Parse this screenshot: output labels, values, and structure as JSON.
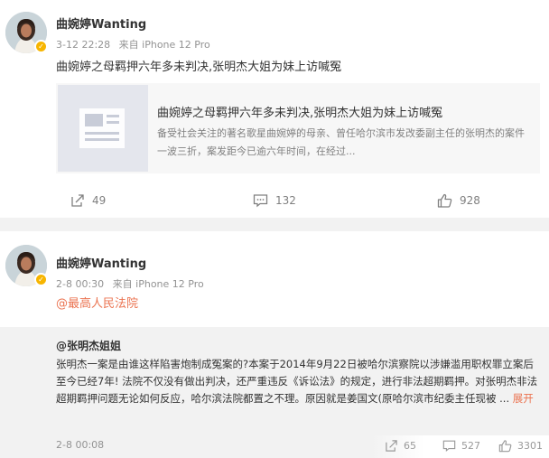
{
  "posts": [
    {
      "username": "曲婉婷Wanting",
      "time": "3-12 22:28",
      "source": "来自 iPhone 12 Pro",
      "text": "曲婉婷之母羁押六年多未判决,张明杰大姐为妹上访喊冤",
      "link_card": {
        "title": "曲婉婷之母羁押六年多未判决,张明杰大姐为妹上访喊冤",
        "summary": "备受社会关注的著名歌星曲婉婷的母亲、曾任哈尔滨市发改委副主任的张明杰的案件一波三折，案发距今已逾六年时间，在经过..."
      },
      "actions": {
        "repost": "49",
        "comment": "132",
        "like": "928"
      }
    },
    {
      "username": "曲婉婷Wanting",
      "time": "2-8 00:30",
      "source": "来自 iPhone 12 Pro",
      "mention": "@最高人民法院",
      "repost": {
        "author": "@张明杰姐姐",
        "text": "张明杰一案是由谁这样陷害炮制成冤案的?本案于2014年9月22日被哈尔滨察院以涉嫌滥用职权罪立案后至今已经7年! 法院不仅没有做出判决，还严重违反《诉讼法》的规定，进行非法超期羁押。对张明杰非法超期羁押问题无论如何反应，哈尔滨法院都置之不理。原因就是姜国文(原哈尔滨市纪委主任现被 ...",
        "expand_label": "展开",
        "time": "2-8 00:08",
        "actions": {
          "repost": "65",
          "comment": "527",
          "like": "3301"
        }
      }
    }
  ],
  "colors": {
    "accent": "#eb7350",
    "badge": "#f7b500",
    "muted": "#939393"
  }
}
